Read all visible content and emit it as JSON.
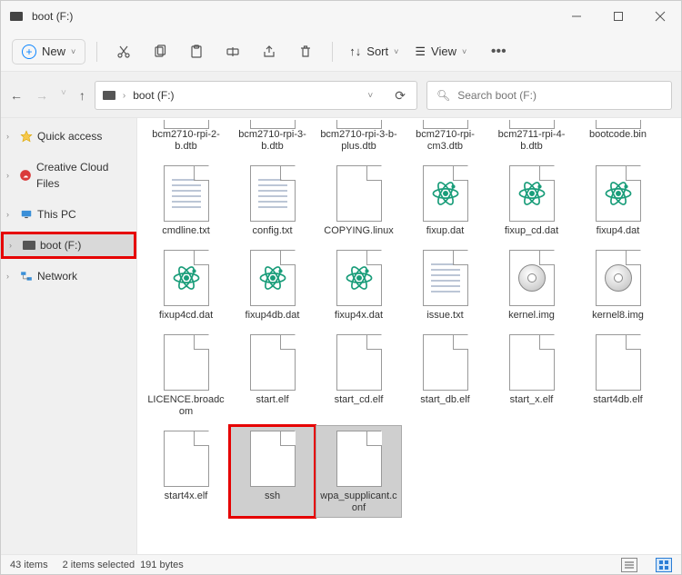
{
  "window": {
    "title": "boot (F:)"
  },
  "toolbar": {
    "new_label": "New",
    "sort_label": "Sort",
    "view_label": "View"
  },
  "address": {
    "path": "boot (F:)"
  },
  "search": {
    "placeholder": "Search boot (F:)"
  },
  "sidebar": {
    "items": [
      {
        "label": "Quick access",
        "icon": "star"
      },
      {
        "label": "Creative Cloud Files",
        "icon": "cc"
      },
      {
        "label": "This PC",
        "icon": "pc"
      },
      {
        "label": "boot (F:)",
        "icon": "drive",
        "selected": true,
        "highlight": true
      },
      {
        "label": "Network",
        "icon": "network"
      }
    ]
  },
  "files": [
    {
      "name": "bcm2710-rpi-2-b.dtb",
      "icon": "generic",
      "row": "short"
    },
    {
      "name": "bcm2710-rpi-3-b.dtb",
      "icon": "generic",
      "row": "short"
    },
    {
      "name": "bcm2710-rpi-3-b-plus.dtb",
      "icon": "generic",
      "row": "short"
    },
    {
      "name": "bcm2710-rpi-cm3.dtb",
      "icon": "generic",
      "row": "short"
    },
    {
      "name": "bcm2711-rpi-4-b.dtb",
      "icon": "generic",
      "row": "short"
    },
    {
      "name": "bootcode.bin",
      "icon": "generic",
      "row": "short"
    },
    {
      "name": "cmdline.txt",
      "icon": "text"
    },
    {
      "name": "config.txt",
      "icon": "text"
    },
    {
      "name": "COPYING.linux",
      "icon": "generic"
    },
    {
      "name": "fixup.dat",
      "icon": "atom"
    },
    {
      "name": "fixup_cd.dat",
      "icon": "atom"
    },
    {
      "name": "fixup4.dat",
      "icon": "atom"
    },
    {
      "name": "fixup4cd.dat",
      "icon": "atom"
    },
    {
      "name": "fixup4db.dat",
      "icon": "atom"
    },
    {
      "name": "fixup4x.dat",
      "icon": "atom"
    },
    {
      "name": "issue.txt",
      "icon": "text"
    },
    {
      "name": "kernel.img",
      "icon": "disc"
    },
    {
      "name": "kernel8.img",
      "icon": "disc"
    },
    {
      "name": "LICENCE.broadcom",
      "icon": "generic"
    },
    {
      "name": "start.elf",
      "icon": "generic"
    },
    {
      "name": "start_cd.elf",
      "icon": "generic"
    },
    {
      "name": "start_db.elf",
      "icon": "generic"
    },
    {
      "name": "start_x.elf",
      "icon": "generic"
    },
    {
      "name": "start4db.elf",
      "icon": "generic"
    },
    {
      "name": "start4x.elf",
      "icon": "generic"
    },
    {
      "name": "ssh",
      "icon": "generic",
      "selected": true,
      "highlight": true
    },
    {
      "name": "wpa_supplicant.conf",
      "icon": "generic",
      "selected": true
    }
  ],
  "status": {
    "count": "43 items",
    "selected": "2 items selected",
    "size": "191 bytes"
  }
}
